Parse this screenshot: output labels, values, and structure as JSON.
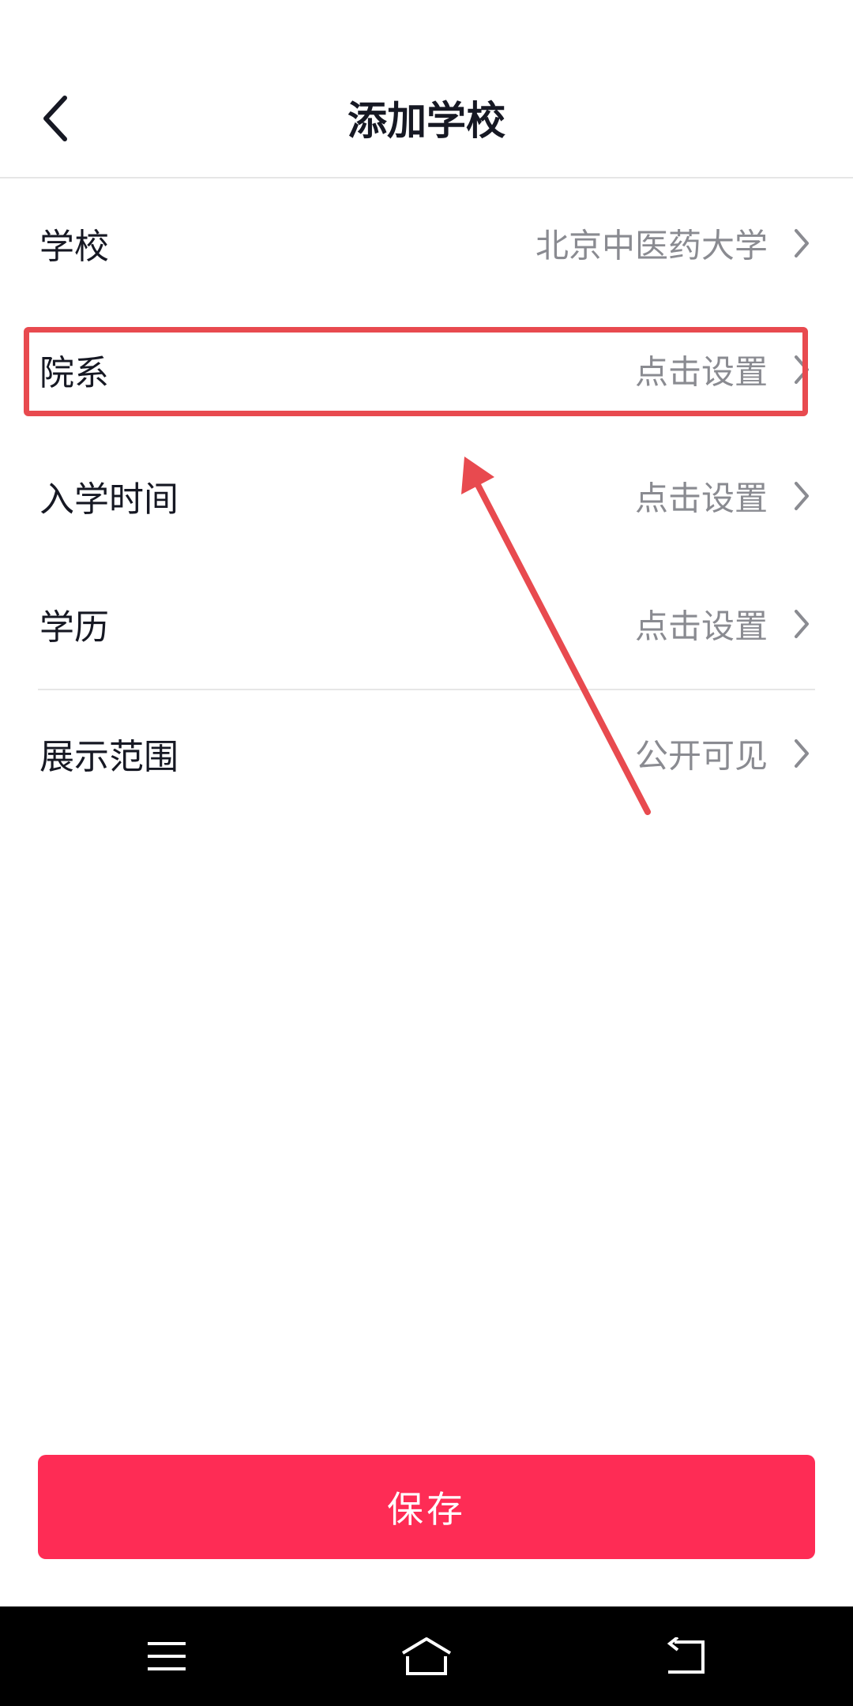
{
  "header": {
    "title": "添加学校",
    "back_icon": "chevron-left-icon"
  },
  "rows": [
    {
      "label": "学校",
      "value": "北京中医药大学"
    },
    {
      "label": "院系",
      "value": "点击设置"
    },
    {
      "label": "入学时间",
      "value": "点击设置"
    },
    {
      "label": "学历",
      "value": "点击设置"
    },
    {
      "label": "展示范围",
      "value": "公开可见"
    }
  ],
  "save_button": {
    "label": "保存"
  },
  "colors": {
    "accent": "#fe2c55",
    "annotation": "#e84a4f",
    "label_text": "#161823",
    "value_text": "#8a8b91"
  },
  "nav_bar": {
    "icons": [
      "menu-icon",
      "home-icon",
      "back-icon"
    ]
  }
}
